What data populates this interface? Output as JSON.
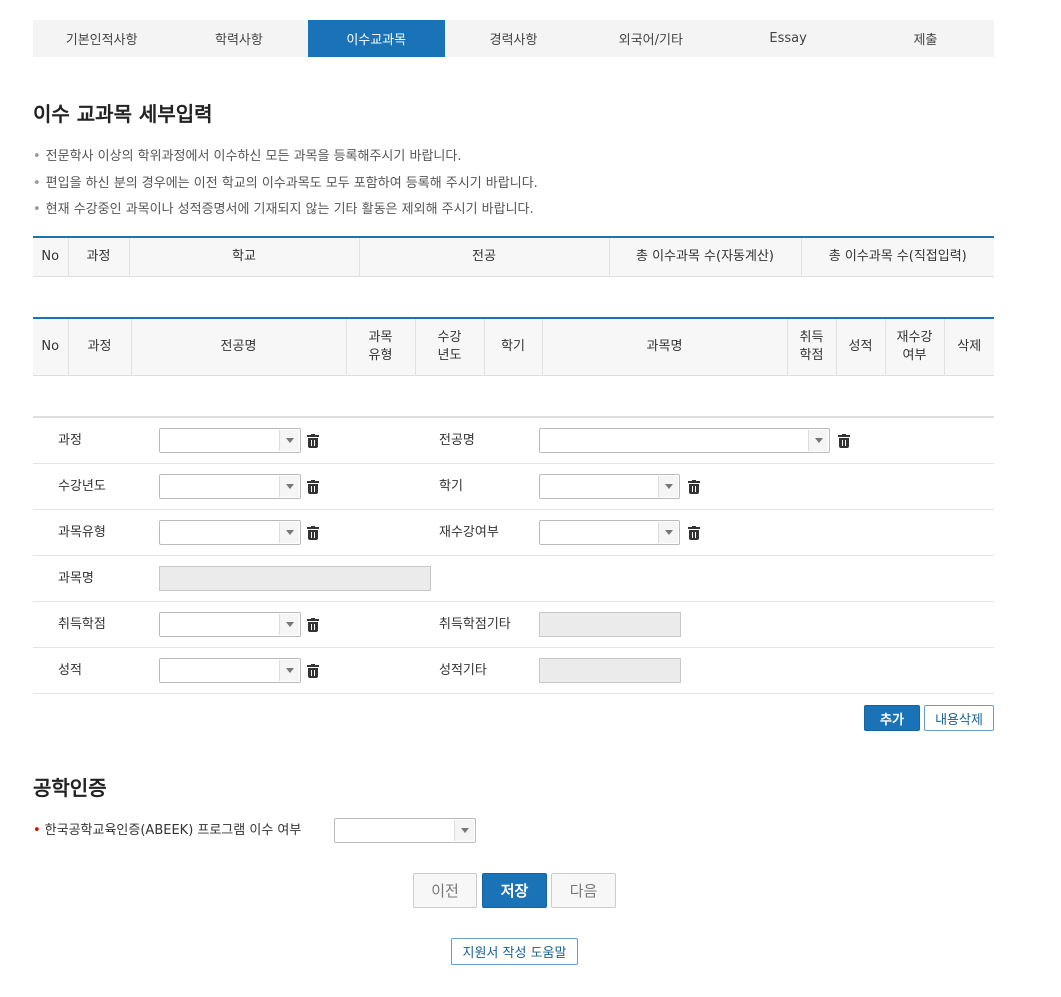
{
  "tabs": [
    "기본인적사항",
    "학력사항",
    "이수교과목",
    "경력사항",
    "외국어/기타",
    "Essay",
    "제출"
  ],
  "active_tab": 2,
  "section1": {
    "title": "이수 교과목 세부입력",
    "notes": [
      "전문학사 이상의 학위과정에서 이수하신 모든 과목을 등록해주시기 바랍니다.",
      "편입을 하신 분의 경우에는 이전 학교의 이수과목도 모두 포함하여 등록해 주시기 바랍니다.",
      "현재 수강중인 과목이나 성적증명서에 기재되지 않는 기타 활동은 제외해 주시기 바랍니다."
    ]
  },
  "table1": {
    "headers": [
      "No",
      "과정",
      "학교",
      "전공",
      "총 이수과목 수(자동계산)",
      "총 이수과목 수(직접입력)"
    ]
  },
  "table2": {
    "h_no": "No",
    "h_course": "과정",
    "h_major": "전공명",
    "h_type_1": "과목",
    "h_type_2": "유형",
    "h_year_1": "수강",
    "h_year_2": "년도",
    "h_semester": "학기",
    "h_subject": "과목명",
    "h_credit_1": "취득",
    "h_credit_2": "학점",
    "h_grade": "성적",
    "h_retake_1": "재수강",
    "h_retake_2": "여부",
    "h_delete": "삭제"
  },
  "form": {
    "course": "과정",
    "major": "전공명",
    "year": "수강년도",
    "semester": "학기",
    "subject_type": "과목유형",
    "retake": "재수강여부",
    "subject_name": "과목명",
    "credit": "취득학점",
    "credit_other": "취득학점기타",
    "grade": "성적",
    "grade_other": "성적기타"
  },
  "buttons": {
    "add": "추가",
    "clear": "내용삭제",
    "prev": "이전",
    "save": "저장",
    "next": "다음",
    "help": "지원서 작성 도움말"
  },
  "section2": {
    "title": "공학인증",
    "abeek_label": "한국공학교육인증(ABEEK) 프로그램 이수 여부"
  },
  "colors": {
    "accent": "#1a73b7",
    "required": "#e00000"
  },
  "icons": {
    "delete": "trash-icon",
    "dropdown": "chevron-down-icon"
  }
}
